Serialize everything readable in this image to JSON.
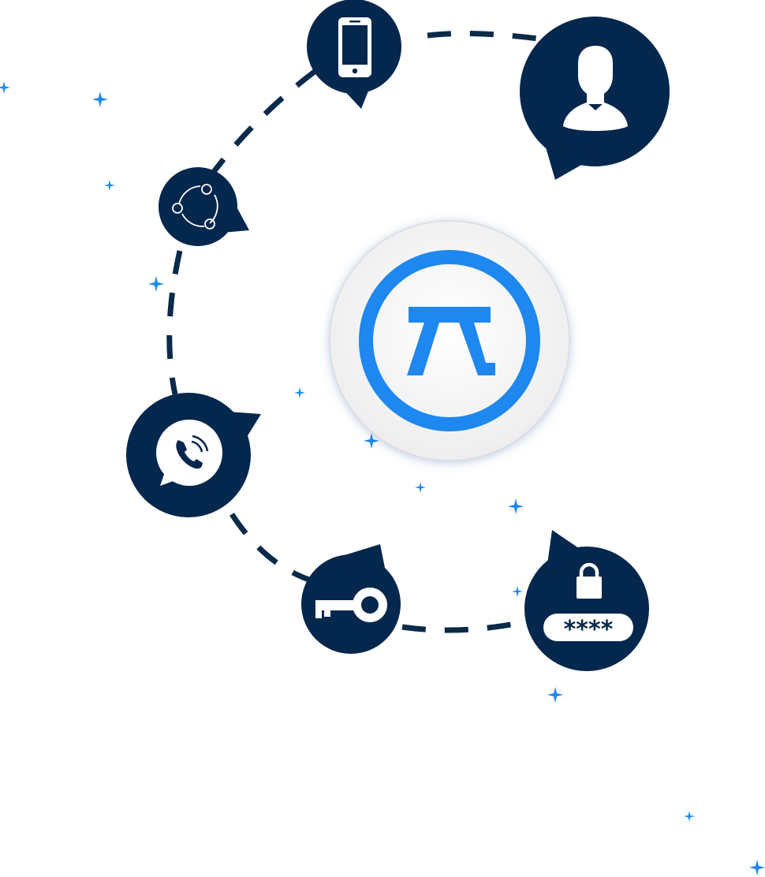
{
  "colors": {
    "navy": "#04274d",
    "accent_blue": "#1e87f0",
    "star_blue": "#1e87f0",
    "background": "#ffffff",
    "center_disc": "#f1f2f4"
  },
  "center_logo": {
    "icon": "pi-logo-icon"
  },
  "nodes": [
    {
      "id": "phone",
      "icon": "smartphone-icon"
    },
    {
      "id": "user",
      "icon": "user-silhouette-icon"
    },
    {
      "id": "share",
      "icon": "share-network-icon"
    },
    {
      "id": "call",
      "icon": "phone-call-bubble-icon"
    },
    {
      "id": "key",
      "icon": "key-icon"
    },
    {
      "id": "password",
      "icon": "lock-icon",
      "text": "****"
    }
  ]
}
